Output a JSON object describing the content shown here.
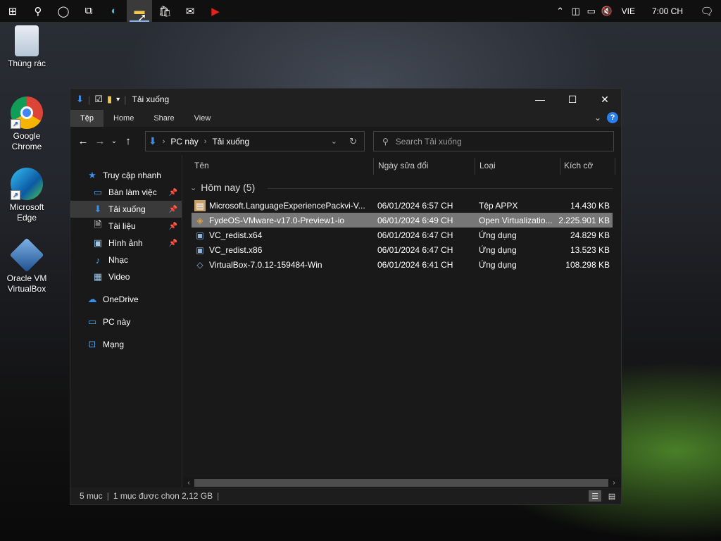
{
  "taskbar": {
    "language": "VIE",
    "clock": "7:00 CH"
  },
  "desktop": {
    "icons": [
      {
        "label": "Thùng rác"
      },
      {
        "label": "Google Chrome"
      },
      {
        "label": "Microsoft Edge"
      },
      {
        "label": "Oracle VM VirtualBox"
      }
    ]
  },
  "window": {
    "title": "Tải xuống",
    "ribbon_tabs": [
      "Tệp",
      "Home",
      "Share",
      "View"
    ],
    "address": {
      "segments": [
        "PC này",
        "Tải xuống"
      ]
    },
    "search_placeholder": "Search Tải xuống"
  },
  "sidebar": {
    "items": [
      {
        "label": "Truy cập nhanh",
        "icon": "star-icon"
      },
      {
        "label": "Bàn làm việc",
        "icon": "desktop-icon",
        "pinned": true
      },
      {
        "label": "Tải xuống",
        "icon": "download-icon",
        "pinned": true,
        "selected": true
      },
      {
        "label": "Tài liệu",
        "icon": "document-icon",
        "pinned": true
      },
      {
        "label": "Hình ảnh",
        "icon": "pictures-icon",
        "pinned": true
      },
      {
        "label": "Nhạc",
        "icon": "music-icon"
      },
      {
        "label": "Video",
        "icon": "video-icon"
      },
      {
        "label": "OneDrive",
        "icon": "cloud-icon"
      },
      {
        "label": "PC này",
        "icon": "pc-icon"
      },
      {
        "label": "Mạng",
        "icon": "network-icon"
      }
    ]
  },
  "files": {
    "columns": [
      "Tên",
      "Ngày sửa đổi",
      "Loại",
      "Kích cỡ"
    ],
    "group_title": "Hôm nay (5)",
    "rows": [
      {
        "name": "Microsoft.LanguageExperiencePackvi-V...",
        "date": "06/01/2024 6:57 CH",
        "type": "Tệp APPX",
        "size": "14.430 KB"
      },
      {
        "name": "FydeOS-VMware-v17.0-Preview1-io",
        "date": "06/01/2024 6:49 CH",
        "type": "Open Virtualizatio...",
        "size": "2.225.901 KB"
      },
      {
        "name": "VC_redist.x64",
        "date": "06/01/2024 6:47 CH",
        "type": "Ứng dụng",
        "size": "24.829 KB"
      },
      {
        "name": "VC_redist.x86",
        "date": "06/01/2024 6:47 CH",
        "type": "Ứng dụng",
        "size": "13.523 KB"
      },
      {
        "name": "VirtualBox-7.0.12-159484-Win",
        "date": "06/01/2024 6:41 CH",
        "type": "Ứng dụng",
        "size": "108.298 KB"
      }
    ]
  },
  "status": {
    "count": "5 mục",
    "selection": "1 mục được chọn  2,12 GB"
  }
}
